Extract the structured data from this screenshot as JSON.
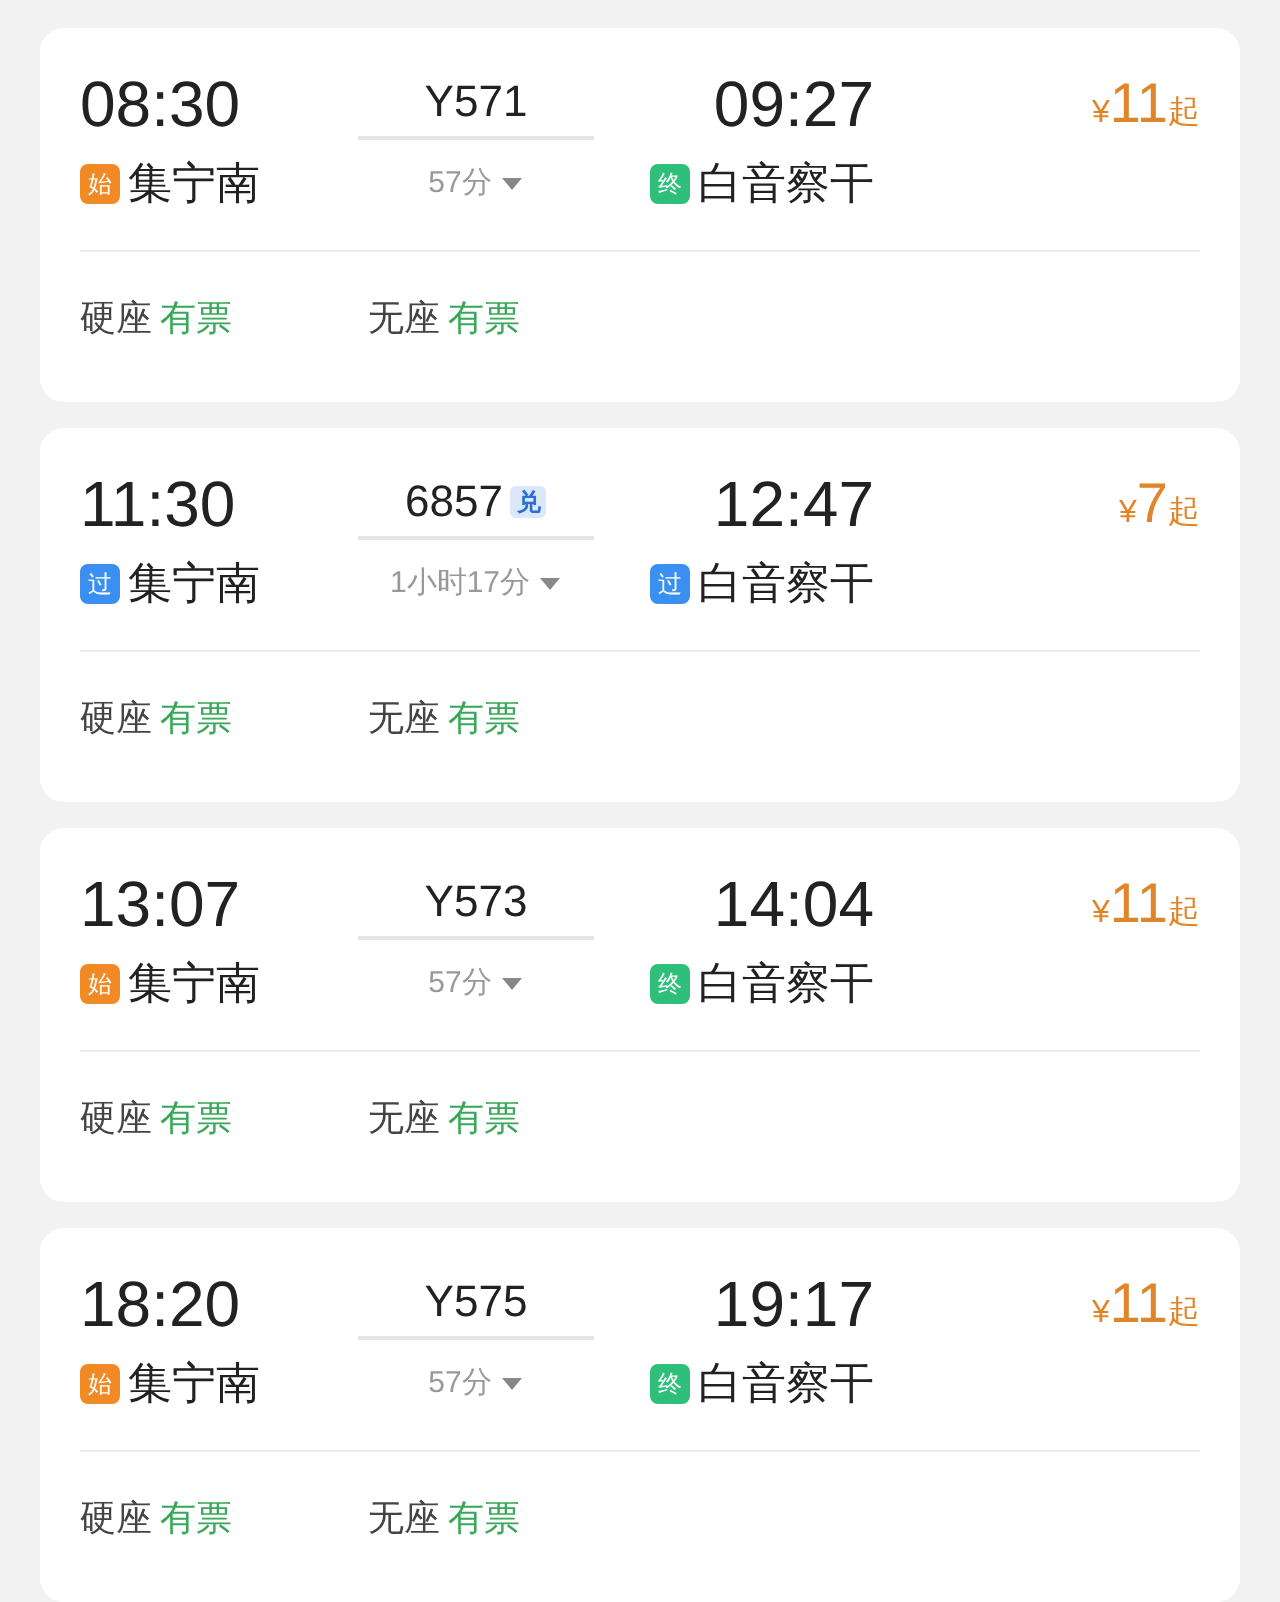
{
  "trains": [
    {
      "depart": "08:30",
      "from": {
        "tag": "始",
        "kind": "start",
        "name": "集宁南"
      },
      "number": "Y571",
      "duration": "57分",
      "arrive": "09:27",
      "to": {
        "tag": "终",
        "kind": "end",
        "name": "白音察干"
      },
      "price_symbol": "¥",
      "price": "11",
      "price_suffix": "起",
      "seats": [
        {
          "class": "硬座",
          "status": "有票"
        },
        {
          "class": "无座",
          "status": "有票"
        }
      ]
    },
    {
      "depart": "11:30",
      "from": {
        "tag": "过",
        "kind": "pass",
        "name": "集宁南"
      },
      "number": "6857",
      "number_tag": "兑",
      "duration": "1小时17分",
      "arrive": "12:47",
      "to": {
        "tag": "过",
        "kind": "pass",
        "name": "白音察干"
      },
      "price_symbol": "¥",
      "price": "7",
      "price_suffix": "起",
      "seats": [
        {
          "class": "硬座",
          "status": "有票"
        },
        {
          "class": "无座",
          "status": "有票"
        }
      ]
    },
    {
      "depart": "13:07",
      "from": {
        "tag": "始",
        "kind": "start",
        "name": "集宁南"
      },
      "number": "Y573",
      "duration": "57分",
      "arrive": "14:04",
      "to": {
        "tag": "终",
        "kind": "end",
        "name": "白音察干"
      },
      "price_symbol": "¥",
      "price": "11",
      "price_suffix": "起",
      "seats": [
        {
          "class": "硬座",
          "status": "有票"
        },
        {
          "class": "无座",
          "status": "有票"
        }
      ]
    },
    {
      "depart": "18:20",
      "from": {
        "tag": "始",
        "kind": "start",
        "name": "集宁南"
      },
      "number": "Y575",
      "duration": "57分",
      "arrive": "19:17",
      "to": {
        "tag": "终",
        "kind": "end",
        "name": "白音察干"
      },
      "price_symbol": "¥",
      "price": "11",
      "price_suffix": "起",
      "seats": [
        {
          "class": "硬座",
          "status": "有票"
        },
        {
          "class": "无座",
          "status": "有票"
        }
      ]
    }
  ]
}
